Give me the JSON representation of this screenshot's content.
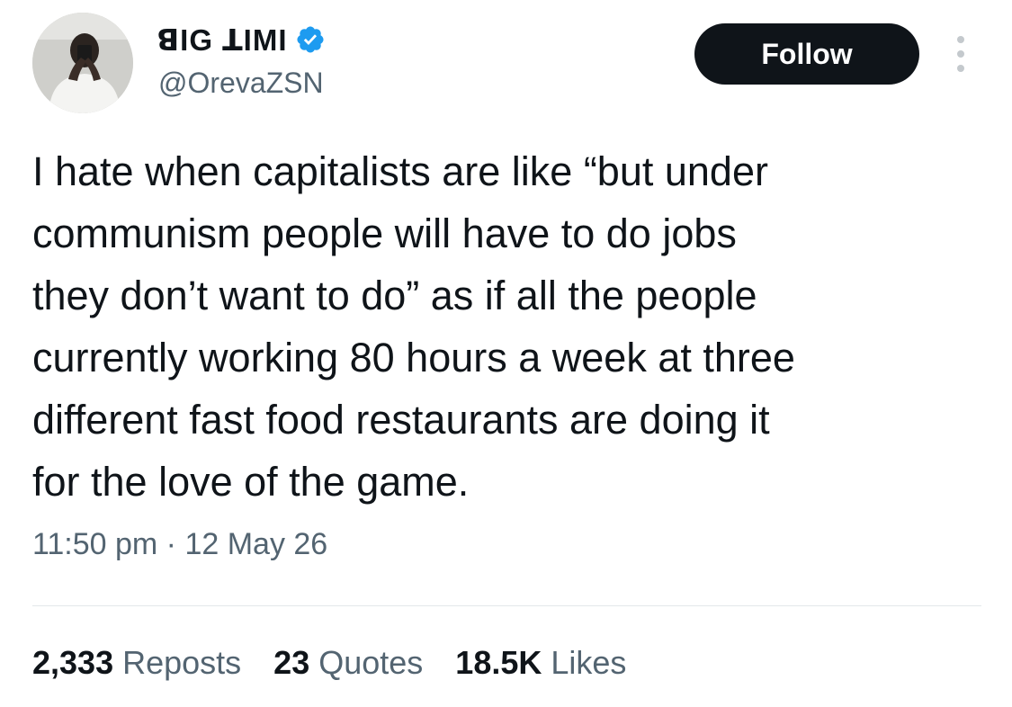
{
  "author": {
    "display_name": "ꓭIG ꓕIMI",
    "handle": "@OrevaZSN",
    "verified": true,
    "verified_color": "#1d9bf0"
  },
  "actions": {
    "follow_label": "Follow",
    "more_icon": "more-vertical-icon"
  },
  "tweet": {
    "text": "I hate when capitalists are like “but under\ncommunism people will have to do jobs\nthey don’t want to do” as if all the people\ncurrently working 80 hours a week at three\ndifferent fast food restaurants are doing it\nfor the love of the game.",
    "timestamp": "11:50 pm · 12 May 26"
  },
  "stats": {
    "reposts_count": "2,333",
    "reposts_label": "Reposts",
    "quotes_count": "23",
    "quotes_label": "Quotes",
    "likes_count": "18.5K",
    "likes_label": "Likes"
  },
  "colors": {
    "text_primary": "#0f1419",
    "text_secondary": "#536471",
    "button_bg": "#0f1419",
    "button_text": "#ffffff"
  }
}
